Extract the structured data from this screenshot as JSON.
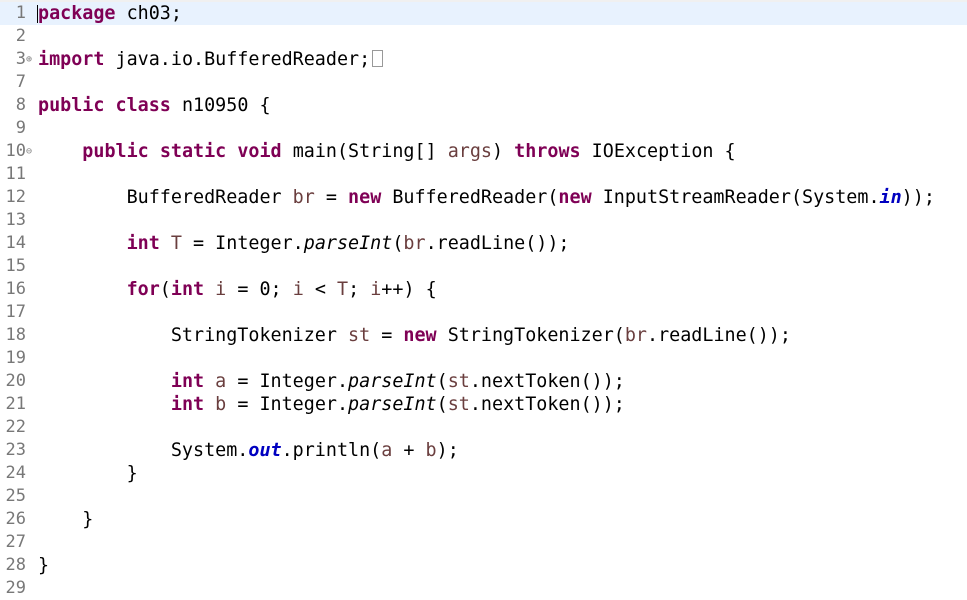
{
  "editor": {
    "current_line": 1,
    "lines": [
      {
        "n": "1",
        "tokens": [
          [
            "k",
            "package"
          ],
          [
            "p",
            " ch03;"
          ]
        ]
      },
      {
        "n": "2",
        "tokens": []
      },
      {
        "n": "3",
        "fold": "expand",
        "folded": true,
        "tokens": [
          [
            "k",
            "import"
          ],
          [
            "p",
            " java.io.BufferedReader;"
          ]
        ]
      },
      {
        "n": "7",
        "tokens": []
      },
      {
        "n": "8",
        "tokens": [
          [
            "k",
            "public"
          ],
          [
            "p",
            " "
          ],
          [
            "k",
            "class"
          ],
          [
            "p",
            " n10950 {"
          ]
        ]
      },
      {
        "n": "9",
        "tokens": []
      },
      {
        "n": "10",
        "fold": "collapse",
        "tokens": [
          [
            "p",
            "    "
          ],
          [
            "k",
            "public"
          ],
          [
            "p",
            " "
          ],
          [
            "k",
            "static"
          ],
          [
            "p",
            " "
          ],
          [
            "k",
            "void"
          ],
          [
            "p",
            " main(String[] "
          ],
          [
            "v",
            "args"
          ],
          [
            "p",
            ") "
          ],
          [
            "k",
            "throws"
          ],
          [
            "p",
            " IOException {"
          ]
        ]
      },
      {
        "n": "11",
        "tokens": []
      },
      {
        "n": "12",
        "tokens": [
          [
            "p",
            "        BufferedReader "
          ],
          [
            "v",
            "br"
          ],
          [
            "p",
            " = "
          ],
          [
            "k",
            "new"
          ],
          [
            "p",
            " BufferedReader("
          ],
          [
            "k",
            "new"
          ],
          [
            "p",
            " InputStreamReader(System."
          ],
          [
            "f",
            "in"
          ],
          [
            "p",
            "));"
          ]
        ]
      },
      {
        "n": "13",
        "tokens": []
      },
      {
        "n": "14",
        "tokens": [
          [
            "p",
            "        "
          ],
          [
            "k",
            "int"
          ],
          [
            "p",
            " "
          ],
          [
            "v",
            "T"
          ],
          [
            "p",
            " = Integer."
          ],
          [
            "m",
            "parseInt"
          ],
          [
            "p",
            "("
          ],
          [
            "v",
            "br"
          ],
          [
            "p",
            ".readLine());"
          ]
        ]
      },
      {
        "n": "15",
        "tokens": []
      },
      {
        "n": "16",
        "tokens": [
          [
            "p",
            "        "
          ],
          [
            "k",
            "for"
          ],
          [
            "p",
            "("
          ],
          [
            "k",
            "int"
          ],
          [
            "p",
            " "
          ],
          [
            "v",
            "i"
          ],
          [
            "p",
            " = 0; "
          ],
          [
            "v",
            "i"
          ],
          [
            "p",
            " < "
          ],
          [
            "v",
            "T"
          ],
          [
            "p",
            "; "
          ],
          [
            "v",
            "i"
          ],
          [
            "p",
            "++) {"
          ]
        ]
      },
      {
        "n": "17",
        "tokens": []
      },
      {
        "n": "18",
        "tokens": [
          [
            "p",
            "            StringTokenizer "
          ],
          [
            "v",
            "st"
          ],
          [
            "p",
            " = "
          ],
          [
            "k",
            "new"
          ],
          [
            "p",
            " StringTokenizer("
          ],
          [
            "v",
            "br"
          ],
          [
            "p",
            ".readLine());"
          ]
        ]
      },
      {
        "n": "19",
        "tokens": []
      },
      {
        "n": "20",
        "tokens": [
          [
            "p",
            "            "
          ],
          [
            "k",
            "int"
          ],
          [
            "p",
            " "
          ],
          [
            "v",
            "a"
          ],
          [
            "p",
            " = Integer."
          ],
          [
            "m",
            "parseInt"
          ],
          [
            "p",
            "("
          ],
          [
            "v",
            "st"
          ],
          [
            "p",
            ".nextToken());"
          ]
        ]
      },
      {
        "n": "21",
        "tokens": [
          [
            "p",
            "            "
          ],
          [
            "k",
            "int"
          ],
          [
            "p",
            " "
          ],
          [
            "v",
            "b"
          ],
          [
            "p",
            " = Integer."
          ],
          [
            "m",
            "parseInt"
          ],
          [
            "p",
            "("
          ],
          [
            "v",
            "st"
          ],
          [
            "p",
            ".nextToken());"
          ]
        ]
      },
      {
        "n": "22",
        "tokens": []
      },
      {
        "n": "23",
        "tokens": [
          [
            "p",
            "            System."
          ],
          [
            "f",
            "out"
          ],
          [
            "p",
            ".println("
          ],
          [
            "v",
            "a"
          ],
          [
            "p",
            " + "
          ],
          [
            "v",
            "b"
          ],
          [
            "p",
            ");"
          ]
        ]
      },
      {
        "n": "24",
        "tokens": [
          [
            "p",
            "        }"
          ]
        ]
      },
      {
        "n": "25",
        "tokens": []
      },
      {
        "n": "26",
        "tokens": [
          [
            "p",
            "    }"
          ]
        ]
      },
      {
        "n": "27",
        "tokens": []
      },
      {
        "n": "28",
        "tokens": [
          [
            "p",
            "}"
          ]
        ]
      },
      {
        "n": "29",
        "tokens": []
      }
    ]
  },
  "colors": {
    "keyword": "#7f0055",
    "variable": "#6a3e3e",
    "static_field": "#0000c0",
    "line_number": "#787878",
    "current_line_bg": "#e8f2fe"
  }
}
